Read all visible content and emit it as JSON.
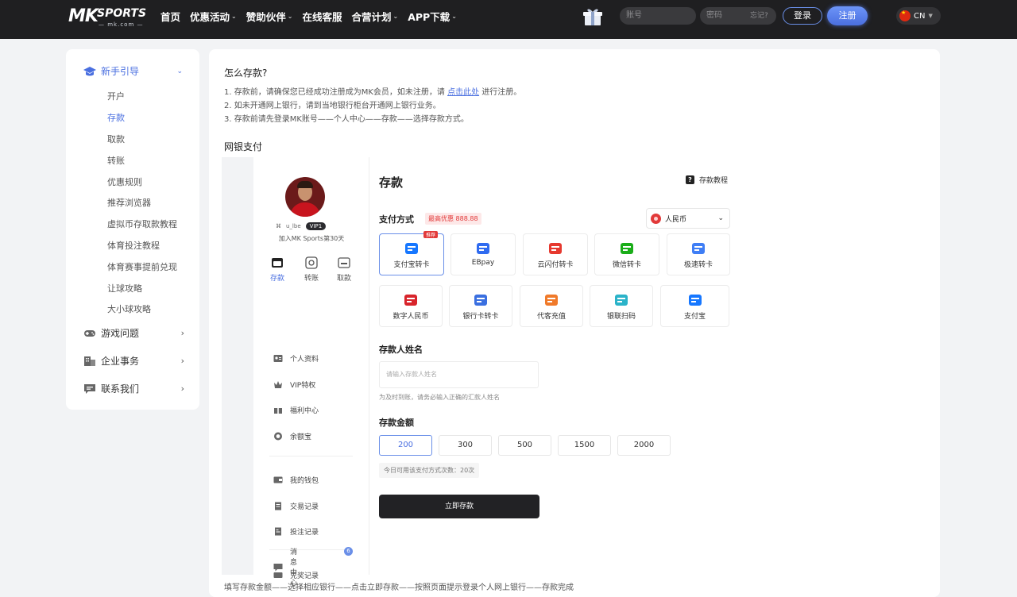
{
  "header": {
    "logo": {
      "mk": "MK",
      "sports": "SPORTS",
      "domain": "— mk.com —"
    },
    "nav": [
      {
        "label": "首页",
        "dropdown": false
      },
      {
        "label": "优惠活动",
        "dropdown": true
      },
      {
        "label": "赞助伙伴",
        "dropdown": true
      },
      {
        "label": "在线客服",
        "dropdown": false
      },
      {
        "label": "合营计划",
        "dropdown": true
      },
      {
        "label": "APP下载",
        "dropdown": true
      }
    ],
    "account_placeholder": "账号",
    "password_placeholder": "密码",
    "forgot": "忘记?",
    "login": "登录",
    "register": "注册",
    "language": "CN"
  },
  "sidebar": {
    "guide": {
      "title": "新手引导",
      "items": [
        {
          "label": "开户",
          "active": false
        },
        {
          "label": "存款",
          "active": true
        },
        {
          "label": "取款",
          "active": false
        },
        {
          "label": "转账",
          "active": false
        },
        {
          "label": "优惠规则",
          "active": false
        },
        {
          "label": "推荐浏览器",
          "active": false
        },
        {
          "label": "虚拟币存取款教程",
          "active": false
        },
        {
          "label": "体育投注教程",
          "active": false
        },
        {
          "label": "体育赛事提前兑现",
          "active": false
        },
        {
          "label": "让球攻略",
          "active": false
        },
        {
          "label": "大小球攻略",
          "active": false
        }
      ]
    },
    "groups": [
      {
        "label": "游戏问题",
        "icon": "gamepad-icon"
      },
      {
        "label": "企业事务",
        "icon": "building-icon"
      },
      {
        "label": "联系我们",
        "icon": "message-icon"
      }
    ]
  },
  "article": {
    "question": "怎么存款?",
    "steps": [
      {
        "before": "1. 存款前，请确保您已经成功注册成为MK会员，如未注册，请 ",
        "link": "点击此处",
        "after": " 进行注册。"
      },
      {
        "before": "2. 如未开通网上银行，请到当地银行柜台开通网上银行业务。",
        "link": "",
        "after": ""
      },
      {
        "before": "3. 存款前请先登录MK账号——个人中心——存款——选择存款方式。",
        "link": "",
        "after": ""
      }
    ],
    "section_title": "网银支付",
    "bottom_note": "填写存款金额——选择相应银行——点击立即存款——按照页面提示登录个人网上银行——存款完成"
  },
  "profile": {
    "username": "u_lbe",
    "vip": "VIP1",
    "join_text": "加入MK Sports第30天",
    "actions": [
      {
        "label": "存款",
        "active": true
      },
      {
        "label": "转账",
        "active": false
      },
      {
        "label": "取款",
        "active": false
      }
    ],
    "menu": [
      {
        "label": "个人资料",
        "icon": "id-card-icon"
      },
      {
        "label": "VIP特权",
        "icon": "crown-icon"
      },
      {
        "label": "福利中心",
        "icon": "gift-icon"
      },
      {
        "label": "余额宝",
        "icon": "coin-icon"
      },
      {
        "label": "我的钱包",
        "icon": "wallet-icon"
      },
      {
        "label": "交易记录",
        "icon": "document-icon"
      },
      {
        "label": "投注记录",
        "icon": "bet-record-icon"
      },
      {
        "label": "兑奖记录",
        "icon": "ticket-icon"
      },
      {
        "label": "消息中心",
        "icon": "chat-icon"
      }
    ],
    "message_count": "6"
  },
  "deposit": {
    "title": "存款",
    "tutorial": "存款教程",
    "payment_label": "支付方式",
    "promo": "最高优惠 888.88",
    "currency": "人民币",
    "methods": [
      {
        "label": "支付宝转卡",
        "tag": "推荐",
        "selected": true,
        "color": "#1677ff"
      },
      {
        "label": "EBpay",
        "tag": "",
        "selected": false,
        "color": "#2f6bf0"
      },
      {
        "label": "云闪付转卡",
        "tag": "",
        "selected": false,
        "color": "#e6392f"
      },
      {
        "label": "微信转卡",
        "tag": "",
        "selected": false,
        "color": "#1aad19"
      },
      {
        "label": "极速转卡",
        "tag": "",
        "selected": false,
        "color": "#3f7ef5"
      },
      {
        "label": "数字人民币",
        "tag": "",
        "selected": false,
        "color": "#d8242b"
      },
      {
        "label": "银行卡转卡",
        "tag": "",
        "selected": false,
        "color": "#3a6fe0"
      },
      {
        "label": "代客充值",
        "tag": "",
        "selected": false,
        "color": "#f07a2a"
      },
      {
        "label": "银联扫码",
        "tag": "",
        "selected": false,
        "color": "#2bb3c9"
      },
      {
        "label": "支付宝",
        "tag": "",
        "selected": false,
        "color": "#1677ff"
      }
    ],
    "name_label": "存款人姓名",
    "name_placeholder": "请输入存款人姓名",
    "name_hint": "为及时到账，请务必输入正确的汇款人姓名",
    "amount_label": "存款金额",
    "amounts": [
      {
        "value": "200",
        "selected": true
      },
      {
        "value": "300",
        "selected": false
      },
      {
        "value": "500",
        "selected": false
      },
      {
        "value": "1500",
        "selected": false
      },
      {
        "value": "2000",
        "selected": false
      }
    ],
    "limit": "今日可用该支付方式次数：20次",
    "submit": "立即存款"
  }
}
